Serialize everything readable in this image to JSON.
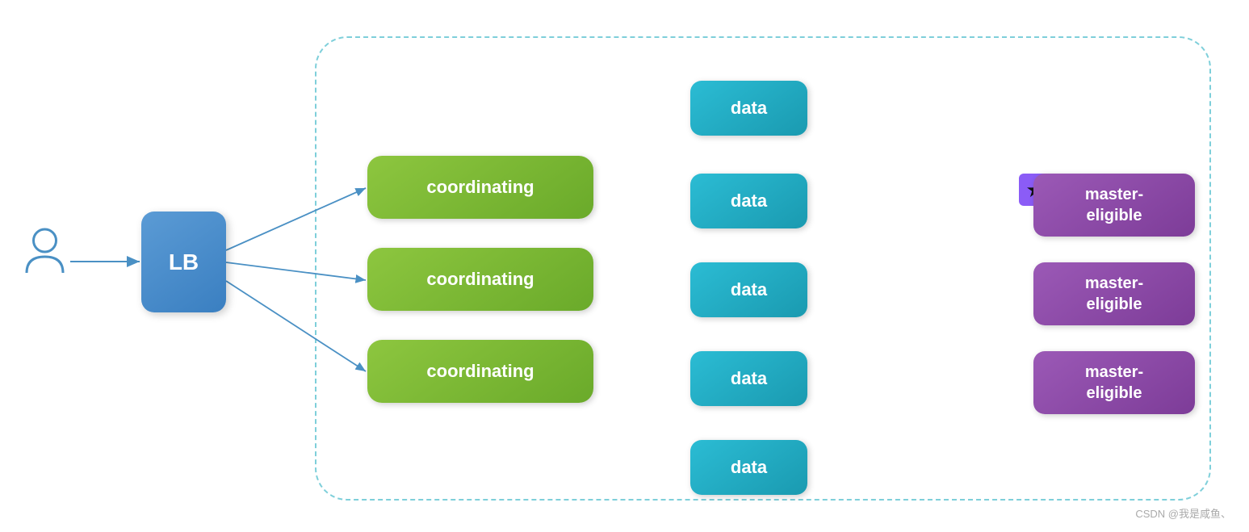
{
  "lb": {
    "label": "LB"
  },
  "coordinating": {
    "boxes": [
      {
        "label": "coordinating"
      },
      {
        "label": "coordinating"
      },
      {
        "label": "coordinating"
      }
    ]
  },
  "data": {
    "boxes": [
      {
        "label": "data"
      },
      {
        "label": "data"
      },
      {
        "label": "data"
      },
      {
        "label": "data"
      },
      {
        "label": "data"
      }
    ]
  },
  "master": {
    "boxes": [
      {
        "label": "master-\neligible"
      },
      {
        "label": "master-\neligible"
      },
      {
        "label": "master-\neligible"
      }
    ]
  },
  "watermark": {
    "text": "CSDN @我是咸鱼、"
  }
}
